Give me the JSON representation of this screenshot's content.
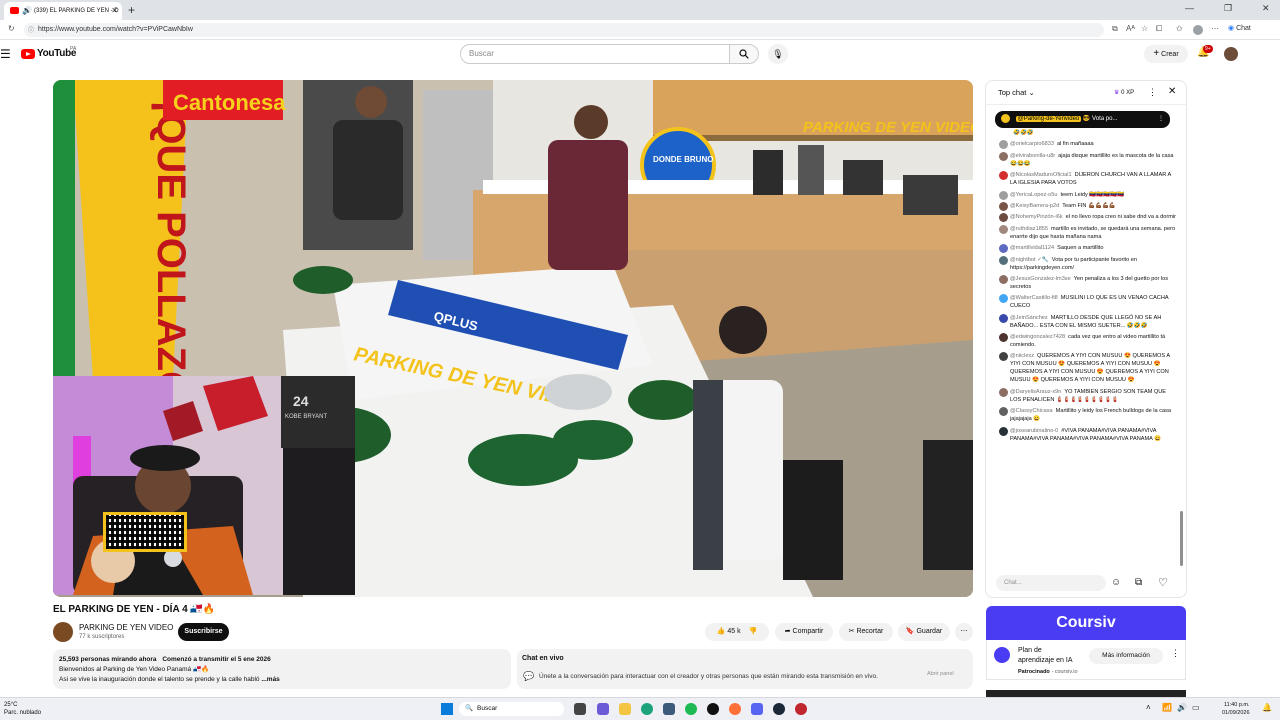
{
  "browser": {
    "tab_title": "(339) EL PARKING DE YEN - D",
    "url": "https://www.youtube.com/watch?v=PViPCawNbIw",
    "chat_label": "Chat"
  },
  "youtube": {
    "logo_text": "YouTube",
    "logo_cc": "PA",
    "search_placeholder": "Buscar",
    "crear_label": "Crear",
    "notif_count": "9+"
  },
  "video": {
    "title": "EL PARKING DE YEN - DÍA 4 🇵🇦🔥",
    "channel": "PARKING DE YEN VIDEO",
    "subscribers": "77 k suscriptores",
    "subscribe_label": "Suscribirse",
    "likes": "45 k",
    "share_label": "Compartir",
    "clip_label": "Recortar",
    "save_label": "Guardar",
    "scene": {
      "sign_cantonesa": "Cantonesa",
      "sign_que_pollazo": "¡QUE POLLAZO",
      "sign_parking": "PARKING DE YEN VIDEO",
      "logo_qplus": "QPLUS",
      "sign_bruno": "DONDE BRUNO",
      "table_logo": "PARKING DE YEN VIDEO",
      "cam_jersey": "24",
      "cam_jersey_name": "KOBE BRYANT"
    }
  },
  "description": {
    "line1_viewers": "25,593 personas mirando ahora",
    "line1_started": "Comenzó a transmitir el 5 ene 2026",
    "line2": "Bienvenidos al Parking de Yen Video Panamá 🇵🇦🔥",
    "line3": "Asi se vive la inauguración donde el talento se prende y la calle habló",
    "more": "...más"
  },
  "live_chat_box": {
    "title": "Chat en vivo",
    "text": "Únete a la conversación para interactuar con el creador y otras personas que están mirando esta transmisión en vivo.",
    "button": "Abrir panel"
  },
  "chat": {
    "header": "Top chat",
    "xp": "0 XP",
    "pinned_author": "@Parking-de-Yenvideo",
    "pinned_text": "😎 Vota po...",
    "input_placeholder": "Chat...",
    "messages": [
      {
        "author": "",
        "text": "🤣🤣🤣",
        "color": "#ffffff"
      },
      {
        "author": "@orielcarpio6833",
        "text": "al fin mañaaaa",
        "color": "#9e9e9e"
      },
      {
        "author": "@elvirabonilla-u8r",
        "text": "ajaja disque martillito es la mascota de la casa 😂😂😂",
        "color": "#8d6e63"
      },
      {
        "author": "@NicolasMaduroOficial1",
        "text": "DIJERON CHURCH VAN A LLAMAR A LA IGLESIA PARA VOTOS",
        "color": "#d32f2f"
      },
      {
        "author": "@YericaLopez-o5u",
        "text": "teem Leidy 🇻🇪🇻🇪🇻🇪🇻🇪🇻🇪",
        "color": "#9e9e9e"
      },
      {
        "author": "@KeisyBarrera-p2d",
        "text": "Team FIN 💪🏾💪🏾💪🏾💪🏾",
        "color": "#795548"
      },
      {
        "author": "@NohemyPinzón-i6k",
        "text": "el no llevo ropa creo ni sabe dnd va a dormir",
        "color": "#6d4c41"
      },
      {
        "author": "@ruthdiaz1855",
        "text": "martillo es invitado, se quedará una semana. pero enarrte dijo que hasta mañana nama",
        "color": "#a1887f"
      },
      {
        "author": "@martillvidal1124",
        "text": "Saquen a martillito",
        "color": "#5c6bc0"
      },
      {
        "author": "@nightbot ✓🔧",
        "text": "Vota por tu participante favorito en https://parkingdeyen.com/",
        "color": "#546e7a"
      },
      {
        "author": "@JesusGonzalez-lm3se",
        "text": "Yen penaliza a los 3 del guetto por los secretos",
        "color": "#8d6e63"
      },
      {
        "author": "@WalterCastillo-fi8",
        "text": "MUSILINI LO QUE ES UN VENAO CACHA CUECO",
        "color": "#42a5f5"
      },
      {
        "author": "@JeinSánchez",
        "text": "MARTILLO DESDE QUE LLEGÓ NO SE AH BAÑADO... ESTA CON EL MISMO SUETER... 🤣🤣🤣",
        "color": "#3949ab"
      },
      {
        "author": "@edwingonzalez7428",
        "text": "cada vez que entro al video martillito tá comiendo.",
        "color": "#4e342e"
      },
      {
        "author": "@niiclexz",
        "text": "QUEREMOS A YIYI CON MUSUU 😍 QUEREMOS A YIYI CON MUSUU 😍 QUEREMOS A YIYI CON MUSUU 😍 QUEREMOS A YIYI CON MUSUU 😍 QUEREMOS A YIYI CON MUSUU 😍 QUEREMOS A YIYI CON MUSUU 😍",
        "color": "#424242"
      },
      {
        "author": "@DaryelisArauz-x9n",
        "text": "YO TAMBIEN SERGIO SON TEAM QUE LOS PENALICEN 🧯🧯🧯🧯🧯🧯🧯🧯🧯",
        "color": "#8d6e63"
      },
      {
        "author": "@ClassyChicasa",
        "text": "Martillito y leidy los French bulldogs de la casa jajajajaja 😄",
        "color": "#616161"
      },
      {
        "author": "@josearubinalino-0",
        "text": "#VIVA PANAMA#VIVA PANAMA#VIVA PANAMA#VIVA PANAMA#VIVA PANAMA#VIVA PANAMA 😄",
        "color": "#263238"
      }
    ]
  },
  "ad": {
    "brand": "Coursiv",
    "title": "Plan de aprendizaje en IA",
    "sponsored": "Patrocinado",
    "domain": "coursiv.io",
    "cta": "Más información"
  },
  "taskbar": {
    "weather_temp": "25°C",
    "weather_desc": "Parc. nublado",
    "search_label": "Buscar",
    "time": "11:40 p.m.",
    "date": "01/09/2026"
  },
  "colors": {
    "yt_red": "#ff0000",
    "ad_bg": "#4a3cf3"
  }
}
